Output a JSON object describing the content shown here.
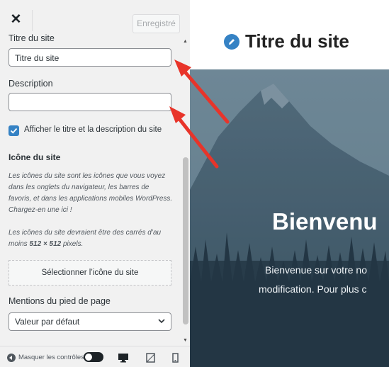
{
  "topbar": {
    "close_symbol": "✕",
    "save_label": "Enregistré"
  },
  "site_identity": {
    "title_label": "Titre du site",
    "title_value": "Titre du site",
    "description_label": "Description",
    "description_value": "",
    "show_title_checkbox_label": "Afficher le titre et la description du site",
    "show_title_checked": true
  },
  "site_icon": {
    "section_title": "Icône du site",
    "help_paragraph_1": "Les icônes du site sont les icônes que vous voyez dans les onglets du navigateur, les barres de favoris, et dans les applications mobiles WordPress. Chargez-en une ici !",
    "help_paragraph_2_prefix": "Les icônes du site devraient être des carrés d’au moins ",
    "help_paragraph_2_size": "512 × 512",
    "help_paragraph_2_suffix": " pixels.",
    "select_button_label": "Sélectionner l’icône du site"
  },
  "footer_credits": {
    "section_title": "Mentions du pied de page",
    "selected_option": "Valeur par défaut"
  },
  "footer": {
    "hide_controls_label": "Masquer les contrôles",
    "devices": [
      "desktop-icon",
      "tablet-icon",
      "mobile-icon"
    ]
  },
  "preview": {
    "site_title": "Titre du site",
    "hero_title": "Bienvenu",
    "hero_text_line1": "Bienvenue sur votre no",
    "hero_text_line2": "modification. Pour plus c"
  },
  "colors": {
    "accent": "#3582c4",
    "arrow": "#e8342a",
    "sidebar_bg": "#f1f1f1"
  }
}
